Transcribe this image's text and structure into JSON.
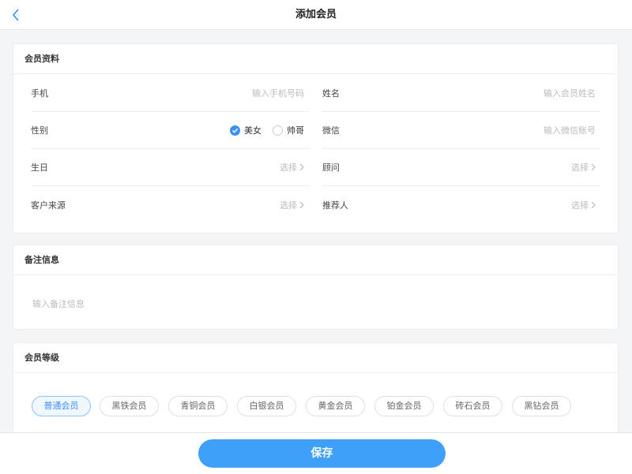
{
  "header": {
    "title": "添加会员"
  },
  "profile": {
    "title": "会员资料",
    "phone": {
      "label": "手机",
      "placeholder": "输入手机号码"
    },
    "name": {
      "label": "姓名",
      "placeholder": "输入会员姓名"
    },
    "gender": {
      "label": "性别",
      "options": [
        "美女",
        "帅哥"
      ],
      "selected": "美女"
    },
    "wechat": {
      "label": "微信",
      "placeholder": "输入微信账号"
    },
    "birthday": {
      "label": "生日",
      "value": "选择"
    },
    "advisor": {
      "label": "顾问",
      "value": "选择"
    },
    "source": {
      "label": "客户来源",
      "value": "选择"
    },
    "referrer": {
      "label": "推荐人",
      "value": "选择"
    }
  },
  "notes": {
    "title": "备注信息",
    "placeholder": "输入备注信息"
  },
  "levels": {
    "title": "会员等级",
    "items": [
      "普通会员",
      "黑铁会员",
      "青铜会员",
      "白银会员",
      "黄金会员",
      "铂金会员",
      "砖石会员",
      "黑钻会员"
    ],
    "selected": "普通会员"
  },
  "footer": {
    "save_label": "保存"
  },
  "colors": {
    "accent": "#3b8ff5",
    "button": "#3fa0f9"
  },
  "icons": {
    "back": "chevron-left-icon",
    "row_arrow": "chevron-right-icon",
    "check": "check-icon"
  }
}
